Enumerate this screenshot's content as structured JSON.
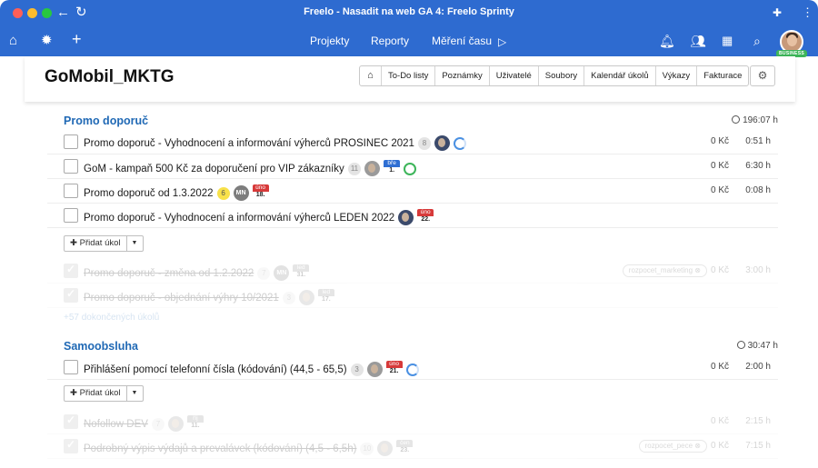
{
  "window": {
    "title": "Freelo - Nasadit na web GA 4: Freelo Sprinty"
  },
  "nav": {
    "links": [
      "Projekty",
      "Reporty",
      "Měření času"
    ],
    "badge": "BUSINESS"
  },
  "project": {
    "title": "GoMobil_MKTG",
    "tabs": [
      "To-Do listy",
      "Poznámky",
      "Uživatelé",
      "Soubory",
      "Kalendář úkolů",
      "Výkazy",
      "Fakturace"
    ]
  },
  "add_task_label": "Přidat úkol",
  "lists": [
    {
      "title": "Promo doporuč",
      "time": "196:07 h",
      "tasks": [
        {
          "name": "Promo doporuč - Vyhodnocení a informování výherců PROSINEC 2021",
          "count": "8",
          "amount": "0 Kč",
          "hours": "0:51 h"
        },
        {
          "name": "GoM - kampaň 500 Kč za doporučení pro VIP zákazníky",
          "count": "11",
          "date_month": "bře",
          "date_day": "1.",
          "amount": "0 Kč",
          "hours": "6:30 h"
        },
        {
          "name": "Promo doporuč od 1.3.2022",
          "count": "6",
          "initials": "MN",
          "date_month": "úno",
          "date_day": "18.",
          "amount": "0 Kč",
          "hours": "0:08 h"
        },
        {
          "name": "Promo doporuč - Vyhodnocení a informování výherců LEDEN 2022",
          "date_month": "úno",
          "date_day": "22."
        }
      ],
      "done_tasks": [
        {
          "name": "Promo doporuč - změna od 1.2.2022",
          "count": "7",
          "initials": "MN",
          "date_month": "led",
          "date_day": "31.",
          "tag": "rozpocet_marketing",
          "amount": "0 Kč",
          "hours": "3:00 h"
        },
        {
          "name": "Promo doporuč - objednání výhry 10/2021",
          "count": "3",
          "date_month": "led",
          "date_day": "17."
        }
      ],
      "more_link": "+57 dokončených úkolů"
    },
    {
      "title": "Samoobsluha",
      "time": "30:47 h",
      "tasks": [
        {
          "name": "Přihlášení pomocí telefonní čísla (kódování) (44,5 - 65,5)",
          "count": "3",
          "date_month": "úno",
          "date_day": "21.",
          "amount": "0 Kč",
          "hours": "2:00 h"
        }
      ],
      "done_tasks": [
        {
          "name": "Nofollow DEV",
          "count": "7",
          "date_month": "říj",
          "date_day": "11.",
          "amount": "0 Kč",
          "hours": "2:15 h"
        },
        {
          "name": "Podrobný výpis výdajů a prevalávek (kódování) (4,5 - 6,5h)",
          "count": "10",
          "date_month": "čen",
          "date_day": "23.",
          "tag": "rozpocet_pece",
          "amount": "0 Kč",
          "hours": "7:15 h"
        }
      ]
    }
  ]
}
